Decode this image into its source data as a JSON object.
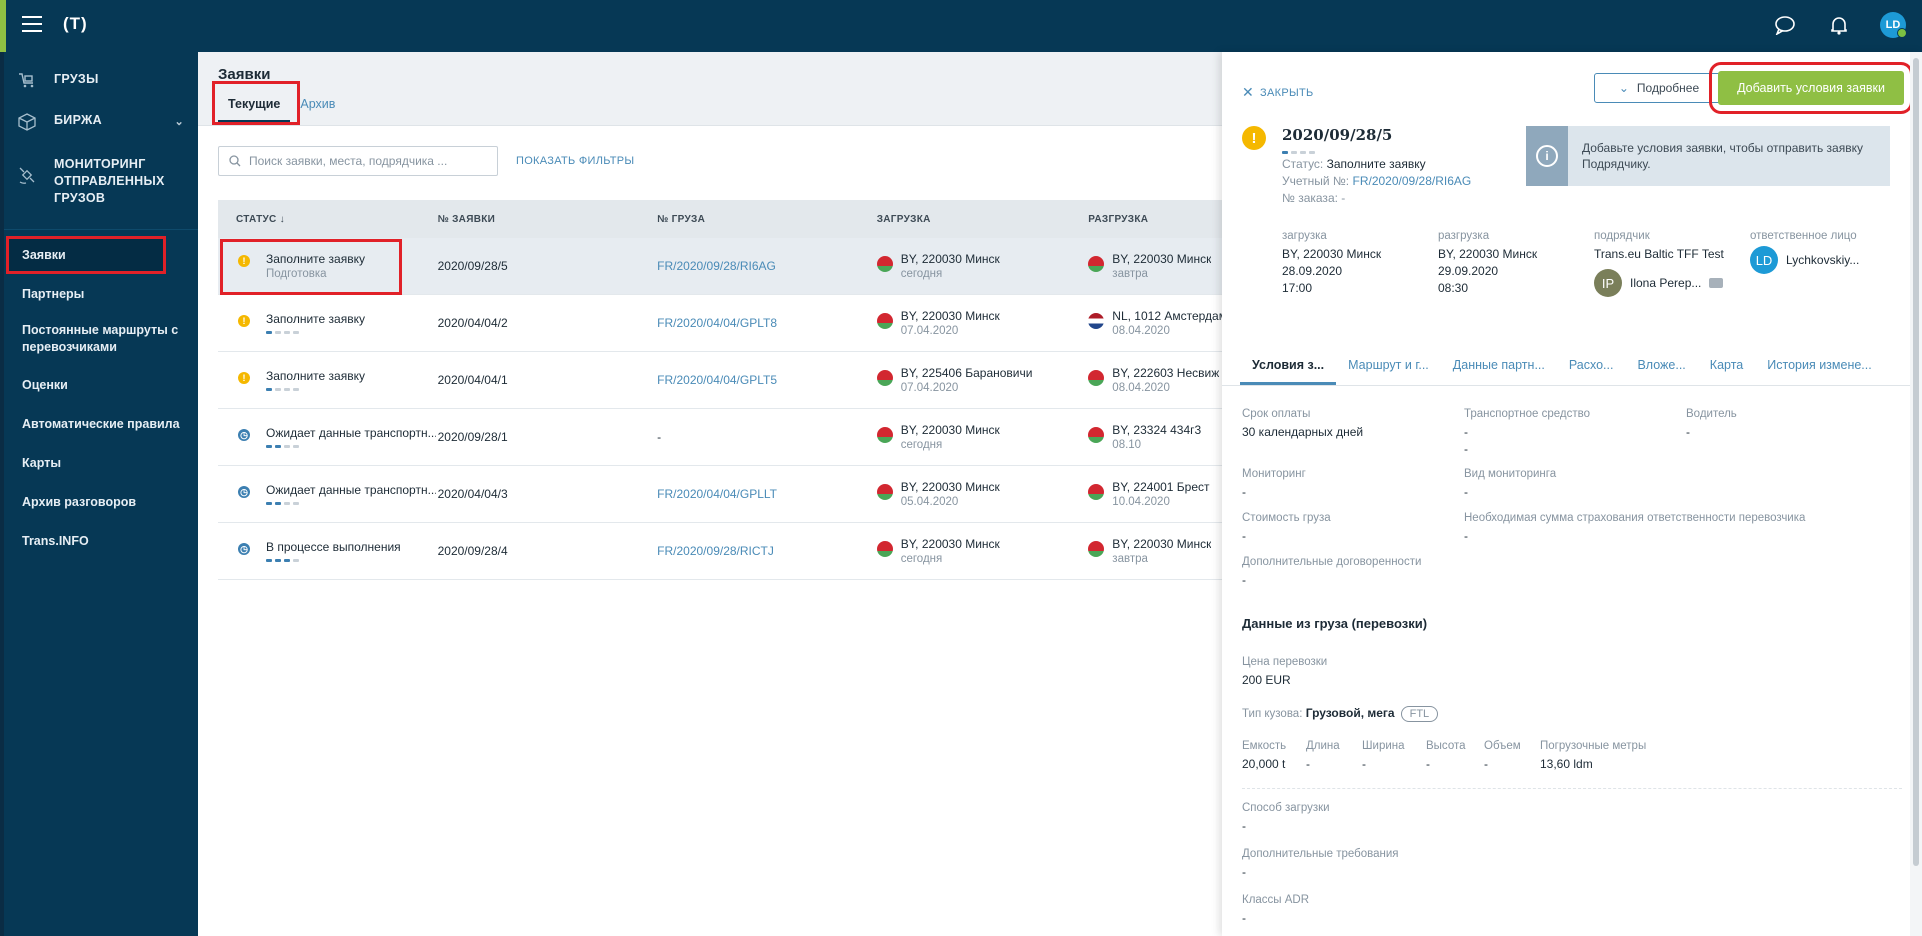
{
  "app": {
    "logo": "(T)",
    "user_initials": "LD"
  },
  "sidebar": {
    "main": [
      {
        "label": "ГРУЗЫ"
      },
      {
        "label": "БИРЖА"
      },
      {
        "label": "МОНИТОРИНГ ОТПРАВЛЕННЫХ ГРУЗОВ"
      }
    ],
    "sub": [
      {
        "label": "Заявки"
      },
      {
        "label": "Партнеры"
      },
      {
        "label": "Постоянные маршруты с перевозчиками"
      },
      {
        "label": "Оценки"
      },
      {
        "label": "Автоматические правила"
      },
      {
        "label": "Карты"
      },
      {
        "label": "Архив разговоров"
      },
      {
        "label": "Trans.INFO"
      }
    ]
  },
  "page": {
    "title": "Заявки",
    "tabs": [
      {
        "label": "Текущие"
      },
      {
        "label": "Архив"
      }
    ],
    "search_placeholder": "Поиск заявки, места, подрядчика ...",
    "show_filters": "ПОКАЗАТЬ ФИЛЬТРЫ"
  },
  "table": {
    "headers": {
      "status": "СТАТУС ↓",
      "num": "№ ЗАЯВКИ",
      "cargo": "№ ГРУЗА",
      "load": "ЗАГРУЗКА",
      "unload": "РАЗГРУЗКА"
    },
    "rows": [
      {
        "status": "Заполните заявку",
        "status_sub": "Подготовка",
        "num": "2020/09/28/5",
        "cargo": "FR/2020/09/28/RI6AG",
        "load": "BY, 220030 Минск",
        "load_date": "сегодня",
        "unload": "BY, 220030 Минск",
        "unload_date": "завтра"
      },
      {
        "status": "Заполните заявку",
        "num": "2020/04/04/2",
        "cargo": "FR/2020/04/04/GPLT8",
        "load": "BY, 220030 Минск",
        "load_date": "07.04.2020",
        "unload": "NL, 1012 Амстердам",
        "unload_date": "08.04.2020"
      },
      {
        "status": "Заполните заявку",
        "num": "2020/04/04/1",
        "cargo": "FR/2020/04/04/GPLT5",
        "load": "BY, 225406 Барановичи",
        "load_date": "07.04.2020",
        "unload": "BY, 222603 Несвиж",
        "unload_date": "08.04.2020"
      },
      {
        "status": "Ожидает данные транспортн...",
        "num": "2020/09/28/1",
        "cargo": "-",
        "load": "BY, 220030 Минск",
        "load_date": "сегодня",
        "unload": "BY, 23324 434г3",
        "unload_date": "08.10"
      },
      {
        "status": "Ожидает данные транспортн...",
        "num": "2020/04/04/3",
        "cargo": "FR/2020/04/04/GPLLT",
        "load": "BY, 220030 Минск",
        "load_date": "05.04.2020",
        "unload": "BY, 224001 Брест",
        "unload_date": "10.04.2020"
      },
      {
        "status": "В процессе выполнения",
        "num": "2020/09/28/4",
        "cargo": "FR/2020/09/28/RICTJ",
        "load": "BY, 220030 Минск",
        "load_date": "сегодня",
        "unload": "BY, 220030 Минск",
        "unload_date": "завтра"
      }
    ]
  },
  "panel": {
    "close": "ЗАКРЫТЬ",
    "more": "Подробнее",
    "add": "Добавить условия заявки",
    "order_title": "2020/09/28/5",
    "status_label": "Статус:",
    "status_value": "Заполните заявку",
    "account_label": "Учетный №:",
    "account_value": "FR/2020/09/28/RI6AG",
    "order_no_label": "№ заказа:",
    "order_no_value": "-",
    "info": "Добавьте условия заявки, чтобы отправить заявку Подрядчику.",
    "summary": {
      "load_label": "загрузка",
      "load_place": "BY, 220030 Минск",
      "load_date": "28.09.2020",
      "load_time": "17:00",
      "unload_label": "разгрузка",
      "unload_place": "BY, 220030 Минск",
      "unload_date": "29.09.2020",
      "unload_time": "08:30",
      "contractor_label": "подрядчик",
      "contractor": "Trans.eu Baltic TFF Test",
      "contact_initials": "IP",
      "contact_name": "Ilona Perep...",
      "resp_label": "ответственное лицо",
      "resp_initials": "LD",
      "resp_name": "Lychkovskiy..."
    },
    "tabs": [
      "Условия з...",
      "Маршрут и г...",
      "Данные партн...",
      "Расхо...",
      "Вложе...",
      "Карта",
      "История измене..."
    ],
    "fields": {
      "pay_term_l": "Срок оплаты",
      "pay_term_v": "30 календарных дней",
      "vehicle_l": "Транспортное средство",
      "vehicle_v": "-",
      "vehicle_v2": "-",
      "driver_l": "Водитель",
      "driver_v": "-",
      "monitoring_l": "Мониторинг",
      "monitoring_v": "-",
      "mon_type_l": "Вид мониторинга",
      "mon_type_v": "-",
      "cargo_cost_l": "Стоимость груза",
      "cargo_cost_v": "-",
      "insurance_l": "Необходимая сумма страхования ответственности перевозчика",
      "insurance_v": "-",
      "extra_l": "Дополнительные договоренности",
      "extra_v": "-"
    },
    "section": "Данные из груза (перевозки)",
    "price_l": "Цена перевозки",
    "price_v": "200 EUR",
    "body_l": "Тип кузова:",
    "body_v": "Грузовой, мега",
    "body_badge": "FTL",
    "dims": [
      {
        "l": "Емкость",
        "v": "20,000 t"
      },
      {
        "l": "Длина",
        "v": "-"
      },
      {
        "l": "Ширина",
        "v": "-"
      },
      {
        "l": "Высота",
        "v": "-"
      },
      {
        "l": "Объем",
        "v": "-"
      },
      {
        "l": "Погрузочные метры",
        "v": "13,60 ldm"
      }
    ],
    "load_method_l": "Способ загрузки",
    "load_method_v": "-",
    "extra_req_l": "Дополнительные требования",
    "extra_req_v": "-",
    "adr_l": "Классы ADR",
    "adr_v": "-"
  }
}
